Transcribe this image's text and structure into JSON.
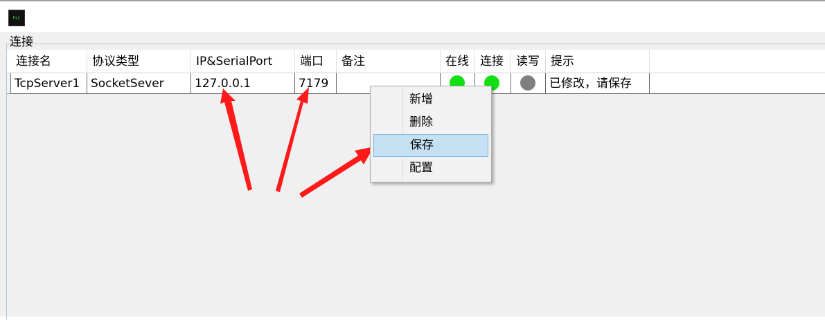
{
  "app": {
    "icon_text": "PLC"
  },
  "group": {
    "title": "连接"
  },
  "table": {
    "columns": [
      "连接名",
      "协议类型",
      "IP&SerialPort",
      "端口",
      "备注",
      "在线",
      "连接",
      "读写",
      "提示"
    ],
    "rows": [
      {
        "name": "TcpServer1",
        "protocol": "SocketSever",
        "address": "127.0.0.1",
        "port": "7179",
        "note": "",
        "online_status": "green",
        "connect_status": "green",
        "rw_status": "gray",
        "hint": "已修改，请保存"
      }
    ]
  },
  "context_menu": {
    "items": [
      "新增",
      "删除",
      "保存",
      "配置"
    ],
    "highlighted": "保存"
  },
  "colors": {
    "status_green": "#12e012",
    "status_gray": "#7f7f7f",
    "highlight": "#c5e0f2",
    "arrow": "#ff1a1a"
  }
}
